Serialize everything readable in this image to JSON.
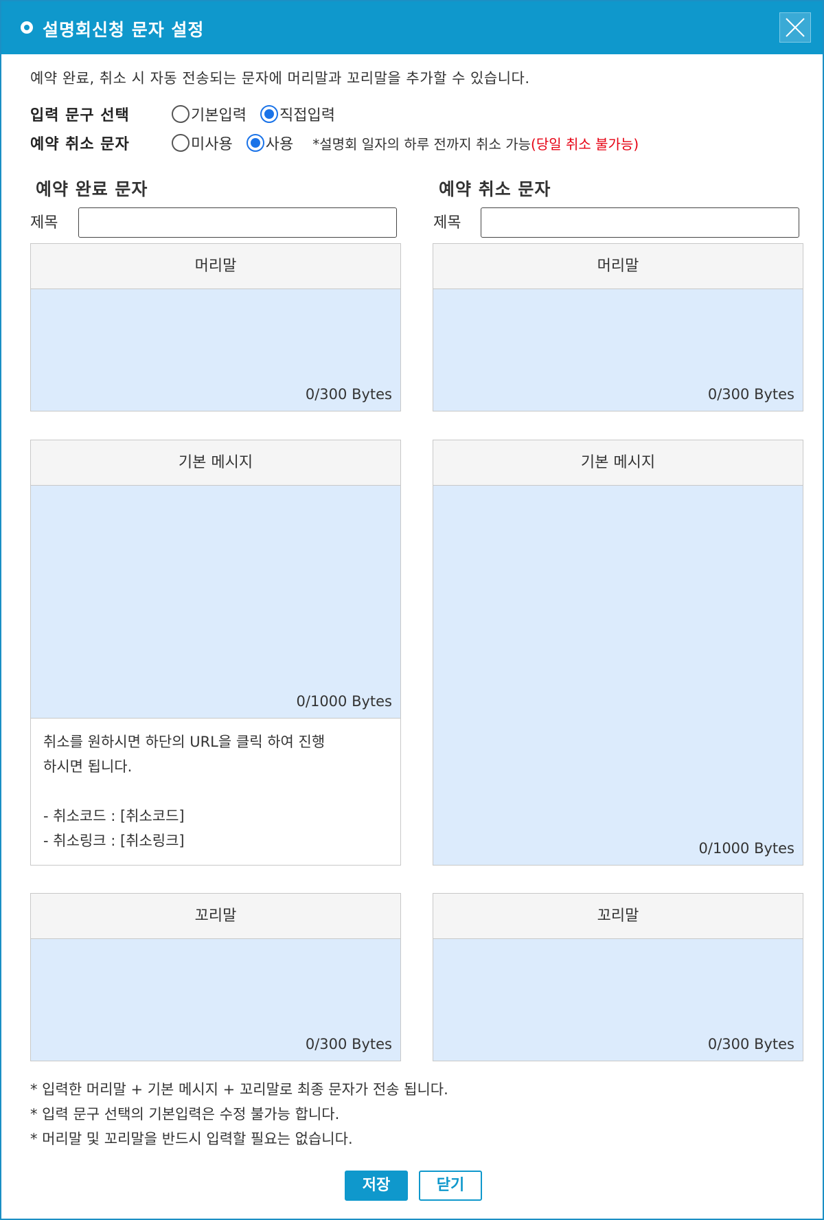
{
  "window": {
    "title": "설명회신청 문자 설정"
  },
  "intro": "예약 완료, 취소 시 자동 전송되는 문자에 머리말과 꼬리말을 추가할 수 있습니다.",
  "options": {
    "input_phrase": {
      "label": "입력 문구 선택",
      "choices": [
        "기본입력",
        "직접입력"
      ],
      "selected": "직접입력"
    },
    "cancel_message": {
      "label": "예약 취소 문자",
      "choices": [
        "미사용",
        "사용"
      ],
      "selected": "사용",
      "note": "*설명회 일자의 하루 전까지 취소 가능",
      "note_red": "(당일 취소 불가능)"
    }
  },
  "left": {
    "title": "예약 완료 문자",
    "subject_label": "제목",
    "subject_value": "",
    "header": {
      "label": "머리말",
      "bytes": "0/300 Bytes"
    },
    "body": {
      "label": "기본 메시지",
      "bytes": "0/1000 Bytes"
    },
    "fixed_text": {
      "line1": "취소를 원하시면 하단의 URL을 클릭 하여 진행",
      "line2": "하시면 됩니다.",
      "line3": "- 취소코드 : [취소코드]",
      "line4": "- 취소링크 : [취소링크]"
    },
    "footer": {
      "label": "꼬리말",
      "bytes": "0/300 Bytes"
    }
  },
  "right": {
    "title": "예약 취소 문자",
    "subject_label": "제목",
    "subject_value": "",
    "header": {
      "label": "머리말",
      "bytes": "0/300 Bytes"
    },
    "body": {
      "label": "기본 메시지",
      "bytes": "0/1000 Bytes"
    },
    "footer": {
      "label": "꼬리말",
      "bytes": "0/300 Bytes"
    }
  },
  "footnotes": [
    "* 입력한 머리말 + 기본 메시지 + 꼬리말로 최종 문자가 전송 됩니다.",
    "* 입력 문구 선택의 기본입력은 수정 불가능 합니다.",
    "* 머리말 및 꼬리말을 반드시 입력할 필요는 없습니다."
  ],
  "buttons": {
    "save": "저장",
    "close": "닫기"
  },
  "colors": {
    "titlebar": "#0f98cc",
    "editor_bg": "#dcebfc",
    "note_red": "#e60012",
    "radio_on": "#1a73e8"
  }
}
